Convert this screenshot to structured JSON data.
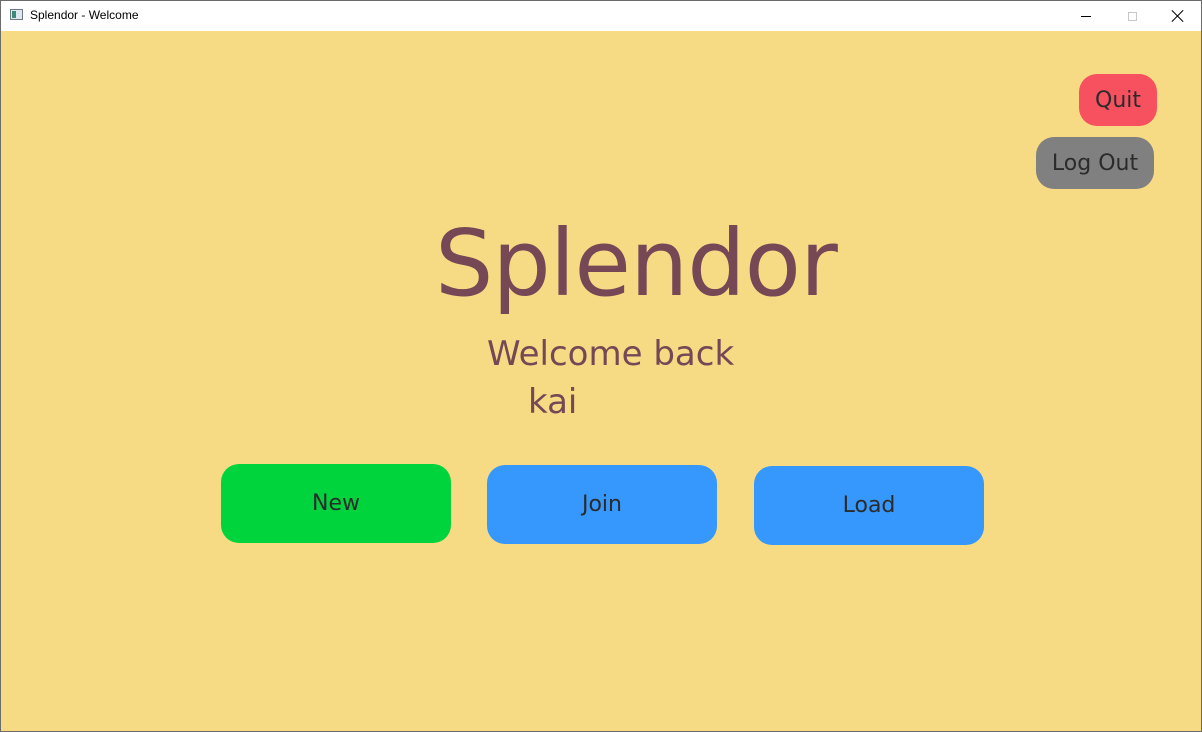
{
  "window": {
    "title": "Splendor - Welcome"
  },
  "header": {
    "quit_label": "Quit",
    "logout_label": "Log Out"
  },
  "main": {
    "title": "Splendor",
    "welcome_text": "Welcome back",
    "username": "kai",
    "actions": {
      "new_label": "New",
      "join_label": "Join",
      "load_label": "Load"
    }
  },
  "colors": {
    "background": "#f6db84",
    "title_text": "#764856",
    "quit": "#f7505f",
    "logout": "#808080",
    "new": "#00d43c",
    "join": "#3698fc",
    "load": "#3698fc"
  },
  "icons": {
    "app": "app-window-icon",
    "minimize": "minimize-icon",
    "maximize": "maximize-icon",
    "close": "close-icon"
  }
}
